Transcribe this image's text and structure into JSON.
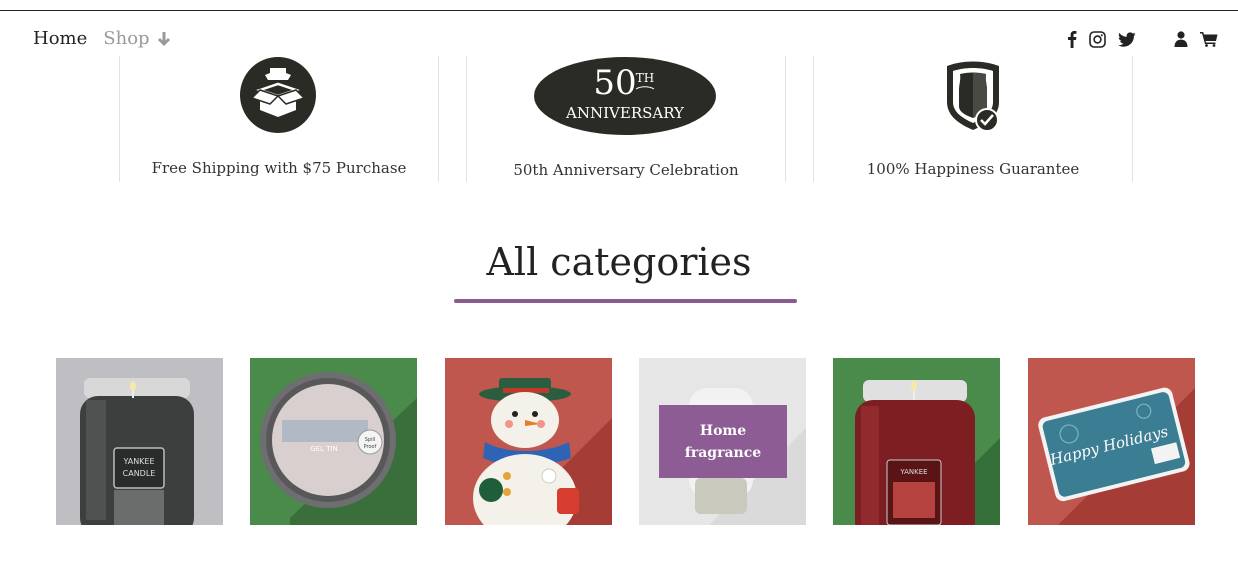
{
  "nav": {
    "home_label": "Home",
    "shop_label": "Shop"
  },
  "header_icons": [
    "facebook-icon",
    "instagram-icon",
    "twitter-icon",
    "user-icon",
    "cart-icon"
  ],
  "features": [
    {
      "icon": "box-icon",
      "text": "Free Shipping with $75 Purchase"
    },
    {
      "icon": "anniversary-badge",
      "badge_number": "50",
      "badge_sup": "TH",
      "badge_word": "ANNIVERSARY",
      "text": "50th Anniversary Celebration"
    },
    {
      "icon": "shield-check-icon",
      "text": "100% Happiness Guarantee"
    }
  ],
  "section": {
    "heading": "All categories",
    "accent_color": "#8b5a91"
  },
  "categories": [
    {
      "name": "black-candle-jar",
      "image_text": "YANKEE CANDLE"
    },
    {
      "name": "scenterpiece-meltcup",
      "image_text": "GEL TIN",
      "label_text": "Spill Proof"
    },
    {
      "name": "snowman-holder"
    },
    {
      "name": "home-fragrance",
      "overlay_label_line1": "Home",
      "overlay_label_line2": "fragrance"
    },
    {
      "name": "red-candle-jar",
      "image_text": "YANKEE CANDLE"
    },
    {
      "name": "gift-card",
      "image_text": "Happy Holidays"
    }
  ]
}
